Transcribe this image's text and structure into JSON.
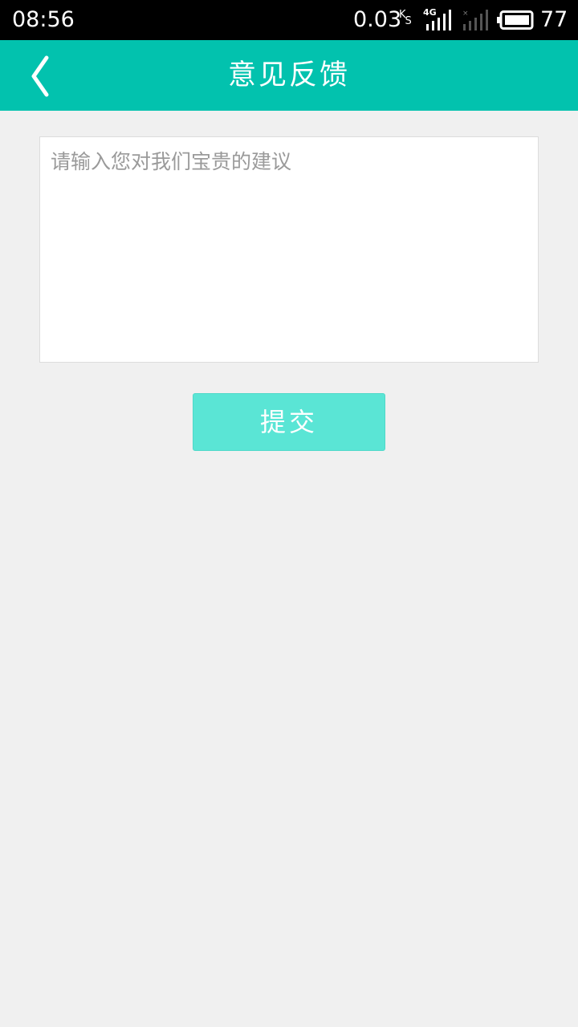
{
  "status_bar": {
    "time": "08:56",
    "speed_value": "0.03",
    "speed_unit_top": "K",
    "speed_unit_bottom": "S",
    "network_type": "4G",
    "battery_level": "77",
    "icons": [
      "signal-icon",
      "signal-no-sim-icon",
      "battery-icon"
    ]
  },
  "app_bar": {
    "title": "意见反馈",
    "back_icon": "chevron-left-icon",
    "color": "#02c2ae"
  },
  "feedback": {
    "placeholder": "请输入您对我们宝贵的建议",
    "value": ""
  },
  "submit": {
    "label": "提交",
    "color": "#5ae5d5"
  },
  "colors": {
    "background": "#f0f0f0",
    "status_bar": "#000000"
  }
}
